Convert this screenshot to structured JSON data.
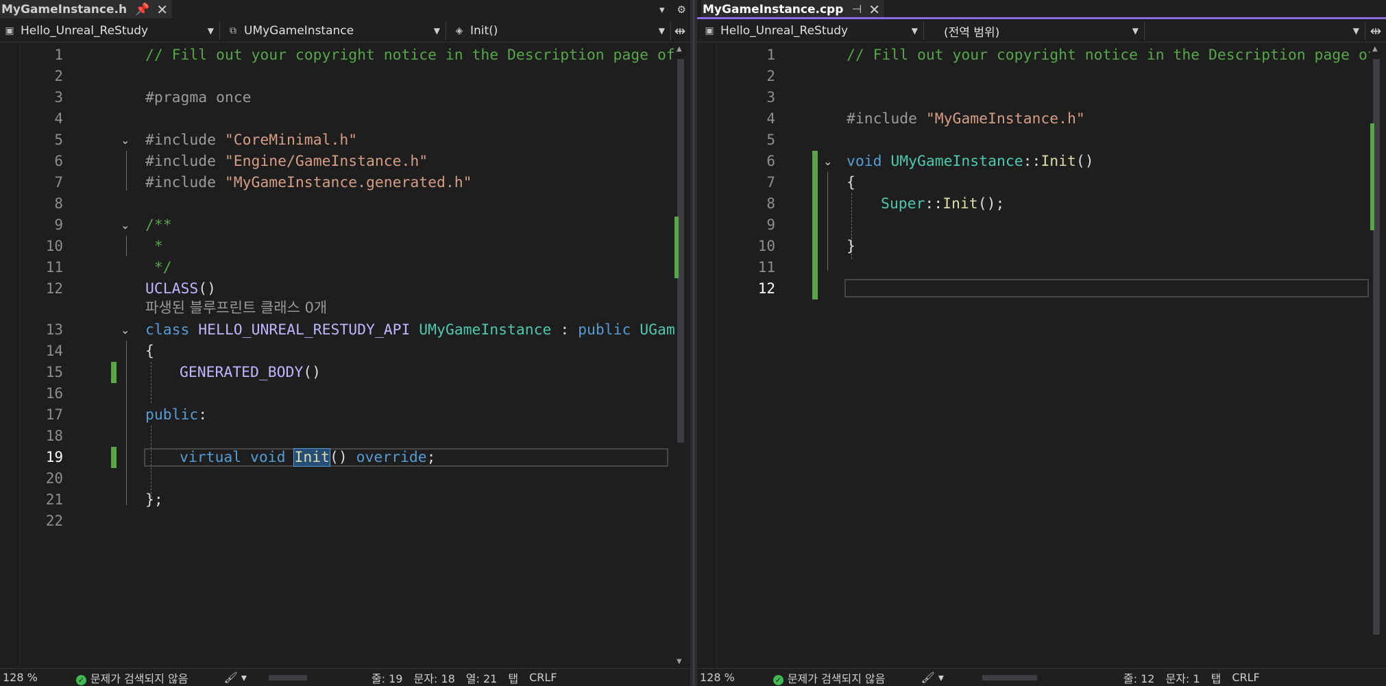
{
  "left": {
    "tab": {
      "title": "MyGameInstance.h",
      "pin": "📌",
      "close": "✕"
    },
    "tabbar_icons": {
      "dropdown": "▾",
      "settings": "⚙"
    },
    "nav": {
      "project": "Hello_Unreal_ReStudy",
      "class": "UMyGameInstance",
      "member": "Init()",
      "split": "⇹"
    },
    "lines": [
      {
        "n": "1"
      },
      {
        "n": "2"
      },
      {
        "n": "3"
      },
      {
        "n": "4"
      },
      {
        "n": "5"
      },
      {
        "n": "6"
      },
      {
        "n": "7"
      },
      {
        "n": "8"
      },
      {
        "n": "9"
      },
      {
        "n": "10"
      },
      {
        "n": "11"
      },
      {
        "n": "12"
      },
      {
        "n": "13"
      },
      {
        "n": "14"
      },
      {
        "n": "15"
      },
      {
        "n": "16"
      },
      {
        "n": "17"
      },
      {
        "n": "18"
      },
      {
        "n": "19"
      },
      {
        "n": "20"
      },
      {
        "n": "21"
      },
      {
        "n": "22"
      }
    ],
    "code": {
      "l1": "// Fill out your copyright notice in the Description page of",
      "l3": "#pragma once",
      "inc": "#include ",
      "l5s": "\"CoreMinimal.h\"",
      "l6s": "\"Engine/GameInstance.h\"",
      "l7s": "\"MyGameInstance.generated.h\"",
      "l9": "/**",
      "l10": " *",
      "l11": " */",
      "l12": "UCLASS",
      "paren": "()",
      "codelens": "파생된 블루프린트 클래스 0개",
      "kw_class": "class",
      "api": "HELLO_UNREAL_RESTUDY_API",
      "cls": "UMyGameInstance",
      "colon_pub": " : ",
      "kw_public": "public",
      "base": "UGame",
      "lbrace": "{",
      "gen": "GENERATED_BODY",
      "public_lbl": "public",
      "colon": ":",
      "kw_virtual": "virtual",
      "kw_void": "void",
      "init": "Init",
      "kw_override": "override",
      "semi": ";",
      "rbrace": "};"
    },
    "status": {
      "zoom": "128 %",
      "issues": "문제가 검색되지 않음",
      "line": "줄: 19",
      "char": "문자: 18",
      "col": "열: 21",
      "tab": "탭",
      "eol": "CRLF"
    }
  },
  "right": {
    "tab": {
      "title": "MyGameInstance.cpp",
      "pin": "⊣",
      "close": "✕"
    },
    "nav": {
      "project": "Hello_Unreal_ReStudy",
      "scope": "(전역 범위)",
      "member": "",
      "split": "⇹"
    },
    "lines": [
      {
        "n": "1"
      },
      {
        "n": "2"
      },
      {
        "n": "3"
      },
      {
        "n": "4"
      },
      {
        "n": "5"
      },
      {
        "n": "6"
      },
      {
        "n": "7"
      },
      {
        "n": "8"
      },
      {
        "n": "9"
      },
      {
        "n": "10"
      },
      {
        "n": "11"
      },
      {
        "n": "12"
      }
    ],
    "code": {
      "l1": "// Fill out your copyright notice in the Description page of",
      "inc": "#include ",
      "l4s": "\"MyGameInstance.h\"",
      "kw_void": "void",
      "cls": "UMyGameInstance",
      "scope": "::",
      "init": "Init",
      "paren": "()",
      "lbrace": "{",
      "super": "Super",
      "call_end": "();",
      "rbrace": "}"
    },
    "status": {
      "zoom": "128 %",
      "issues": "문제가 검색되지 않음",
      "line": "줄: 12",
      "char": "문자: 1",
      "tab": "탭",
      "eol": "CRLF"
    }
  },
  "colors": {
    "accent": "#8a6be8",
    "change_bar": "#57a64a",
    "comment": "#57a64a",
    "keyword": "#569cd6",
    "string": "#d69d85",
    "type": "#4ec9b0"
  }
}
